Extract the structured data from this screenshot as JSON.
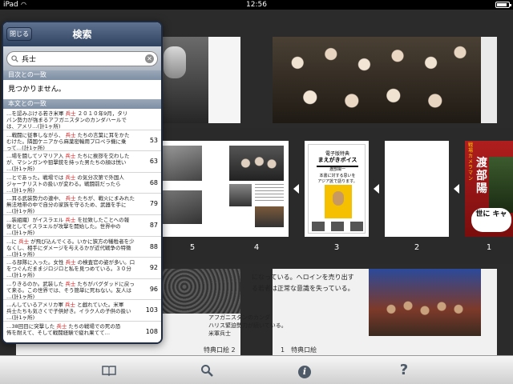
{
  "status_bar": {
    "carrier": "iPad",
    "time": "12:56"
  },
  "search_popover": {
    "close_label": "閉じる",
    "title": "検索",
    "search_query": "兵士",
    "toc_section_label": "目次との一致",
    "toc_no_results": "見つかりません。",
    "body_section_label": "本文との一致",
    "results": [
      {
        "line1_pre": "…を認みぶける若き米軍",
        "keyword": "兵士",
        "line1_post": "２０１０年9月，タリ",
        "line2": "バン勢力が強まるアフガニスタンのカンダハールで",
        "line3": "は、アメリ…(計1ヶ所)",
        "page": ""
      },
      {
        "line1_pre": "…戦闘に従事しながら、",
        "keyword": "兵士",
        "line1_post": "たちの言葉に耳をかた",
        "line2": "むけた。隣国ケニアから麻薬密輸用プロペラ機に乗",
        "line3": "って…(計1ヶ所)",
        "page": "53"
      },
      {
        "line1_pre": "…場を闘してソマリア入",
        "keyword": "兵士",
        "line1_post": "たちに挨拶を交わした",
        "line2": "が、マシンガンや狙撃銃を持った男たちの顔は悦い",
        "line3": "…(計1ヶ所)",
        "page": "63"
      },
      {
        "line1_pre": "…とであった。戦場では",
        "keyword": "兵士",
        "line1_post": "の気分次第で外国人",
        "line2": "ジャーナリストの扱いが変わる。戦闘前だったら",
        "line3": "…(計1ヶ所)",
        "page": "68"
      },
      {
        "line1_pre": "…耳る武装勢力の連中、",
        "keyword": "兵士",
        "line1_post": "たちが、戦火にまみれた",
        "line2": "無法地帯の中で自分の家族を守るため、武器を手に",
        "line3": "…(計1ヶ所)",
        "page": "79"
      },
      {
        "line1_pre": "…装組織）がイスラエル",
        "keyword": "兵士",
        "line1_post": "を拉致したことへの報",
        "line2": "復としてイスラエルが攻撃を開始した。世界中の",
        "line3": "…(計1ヶ所)",
        "page": "87"
      },
      {
        "line1_pre": "…に",
        "keyword": "兵士",
        "line1_post": "が飛び込んでくる。いかに狭方の犠牲者を少",
        "line2": "なくし、相手にダメージを与えるかが近代戦争の特徴",
        "line3": "…(計1ヶ所)",
        "page": "88"
      },
      {
        "line1_pre": "…る部隊に入った。女性",
        "keyword": "兵士",
        "line1_post": "の検査官の姿が多い。口",
        "line2": "をつぐんだままジロジロと私を見つめている。３０分",
        "line3": "…(計1ヶ所)",
        "page": "92"
      },
      {
        "line1_pre": "…りきるのか。武装した",
        "keyword": "兵士",
        "line1_post": "たちがバグダッドに戻っ",
        "line2": "て来る。この世界では、そう簡単に死ねない。友人は",
        "line3": "…(計1ヶ所)",
        "page": "96"
      },
      {
        "line1_pre": "…んしているアメリカ軍",
        "keyword": "兵士",
        "line1_post": "と戯れていた。米軍",
        "line2": "兵士たちも気さくで子供好き。イラク人の子供の扱い",
        "line3": "…(計1ヶ所)",
        "page": "103"
      },
      {
        "line1_pre": "…38回目に突撃した",
        "keyword": "兵士",
        "line1_post": "たちの戦場での死の恐",
        "line2": "怖を耐えて、そして戦闘経験で疲れ果てて…",
        "line3": "",
        "page": "108"
      }
    ]
  },
  "thumbnails": [
    {
      "number": "5"
    },
    {
      "number": "4"
    },
    {
      "number": "3",
      "title_line1": "電子版特典",
      "title_line2": "まえがきボイス",
      "author": "渡部陽一",
      "line_a": "本書に対する思いを",
      "line_b": "アジア訛で語ります。"
    },
    {
      "number": "2"
    },
    {
      "number": "1",
      "vertical_small": "戦場カメラマン",
      "vertical_big": "渡部陽",
      "bubble_text": "世に キャ"
    }
  ],
  "book": {
    "lower_text_lines": [
      "になっている。へロインを売り出す",
      "る若者は正常な意識を失っている。"
    ],
    "caption_a": "アフガニスタンのカンダ",
    "caption_b": "ハリス緊迫勢力が続いている。",
    "caption_c": "米軍兵士",
    "footer_left": "特典口絵 2",
    "footer_right": "1　特典口絵"
  },
  "toolbar": {
    "items": [
      "book-icon",
      "search-icon",
      "info-icon",
      "help-icon"
    ],
    "info_glyph": "i",
    "help_glyph": "?"
  }
}
